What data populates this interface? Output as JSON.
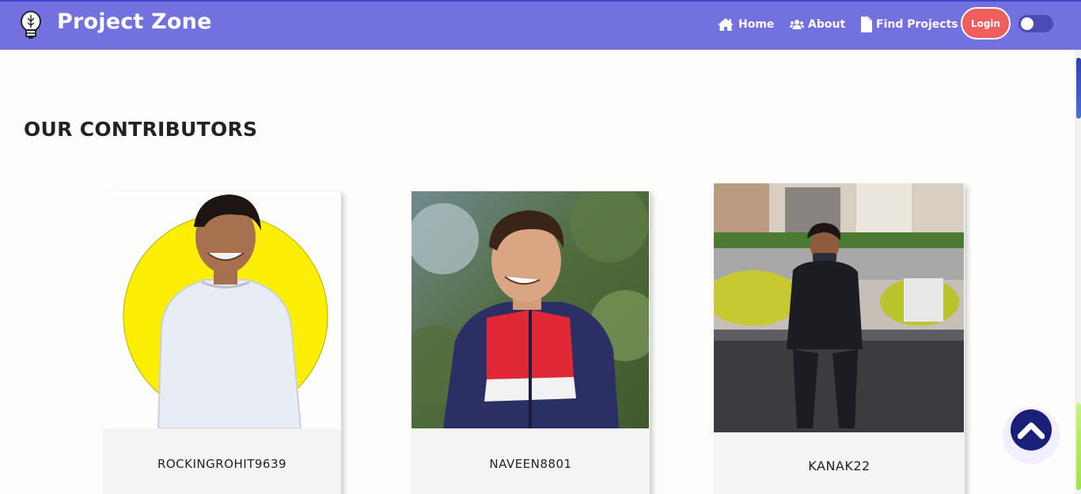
{
  "navbar": {
    "brand": "Project Zone",
    "links": [
      {
        "label": "Home",
        "icon": "home-icon"
      },
      {
        "label": "About",
        "icon": "users-icon"
      },
      {
        "label": "Find Projects",
        "icon": "file-icon"
      }
    ],
    "login_label": "Login",
    "theme_toggle": "dark-mode-toggle",
    "color": "#7370e0"
  },
  "main": {
    "section_title": "OUR CONTRIBUTORS",
    "contributors": [
      {
        "username": "ROCKINGROHIT9639",
        "photo": "contributor-photo-yellow-circle"
      },
      {
        "username": "NAVEEN8801",
        "photo": "contributor-photo-outdoor"
      },
      {
        "username": "KANAK22",
        "photo": "contributor-photo-plaza"
      }
    ]
  },
  "scroll_top": {
    "icon": "chevron-up-icon"
  }
}
